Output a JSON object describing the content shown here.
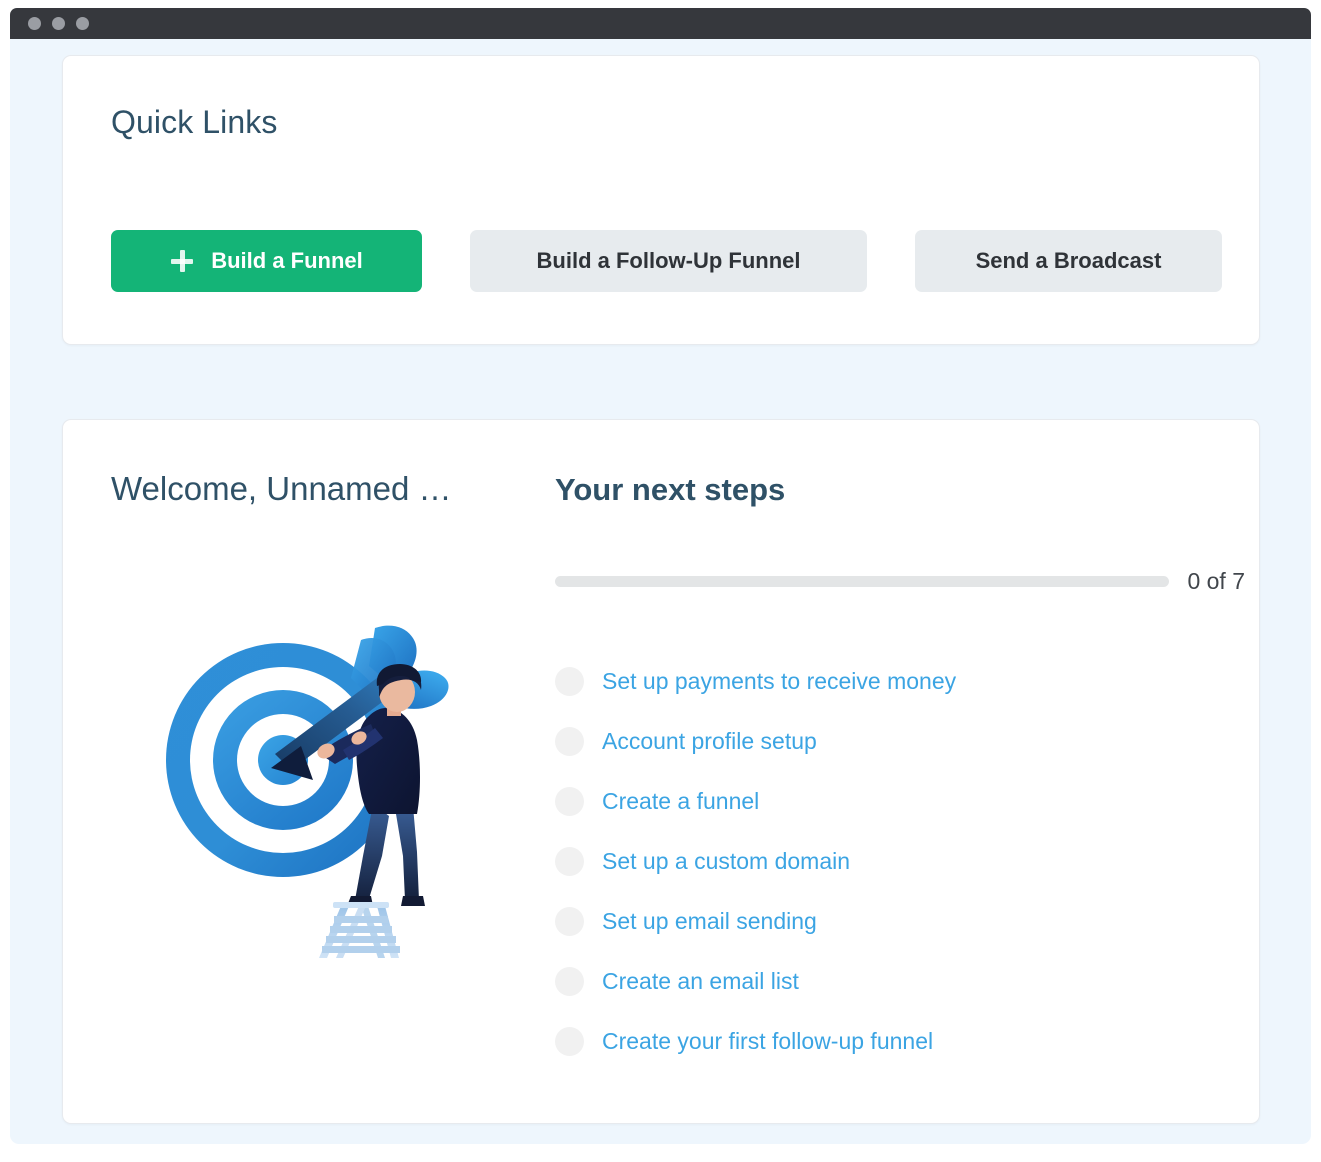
{
  "window": {
    "traffic_lights": [
      "window-dot-1",
      "window-dot-2",
      "window-dot-3"
    ]
  },
  "quick_links": {
    "title": "Quick Links",
    "buttons": [
      {
        "label": "Build a Funnel",
        "icon": "plus-icon",
        "style": "primary"
      },
      {
        "label": "Build a Follow-Up Funnel",
        "style": "secondary"
      },
      {
        "label": "Send a Broadcast",
        "style": "secondary"
      }
    ]
  },
  "welcome": {
    "title": "Welcome, Unnamed …",
    "illustration_name": "target-dart-ladder-illustration"
  },
  "next_steps": {
    "title": "Your next steps",
    "progress_label": "0 of 7",
    "completed": 0,
    "total": 7,
    "progress_percent": 0,
    "items": [
      {
        "label": "Set up payments to receive money",
        "done": false
      },
      {
        "label": "Account profile setup",
        "done": false
      },
      {
        "label": "Create a funnel",
        "done": false
      },
      {
        "label": "Set up a custom domain",
        "done": false
      },
      {
        "label": "Set up email sending",
        "done": false
      },
      {
        "label": "Create an email list",
        "done": false
      },
      {
        "label": "Create your first follow-up funnel",
        "done": false
      }
    ]
  },
  "colors": {
    "page_background": "#eef6fd",
    "card_background": "#ffffff",
    "titlebar": "#36383d",
    "heading": "#2f5167",
    "primary_green": "#14b477",
    "secondary_gray": "#e7ebee",
    "link_blue": "#3ba4e3",
    "progress_track": "#e3e5e6",
    "step_circle": "#f1f1f1"
  }
}
